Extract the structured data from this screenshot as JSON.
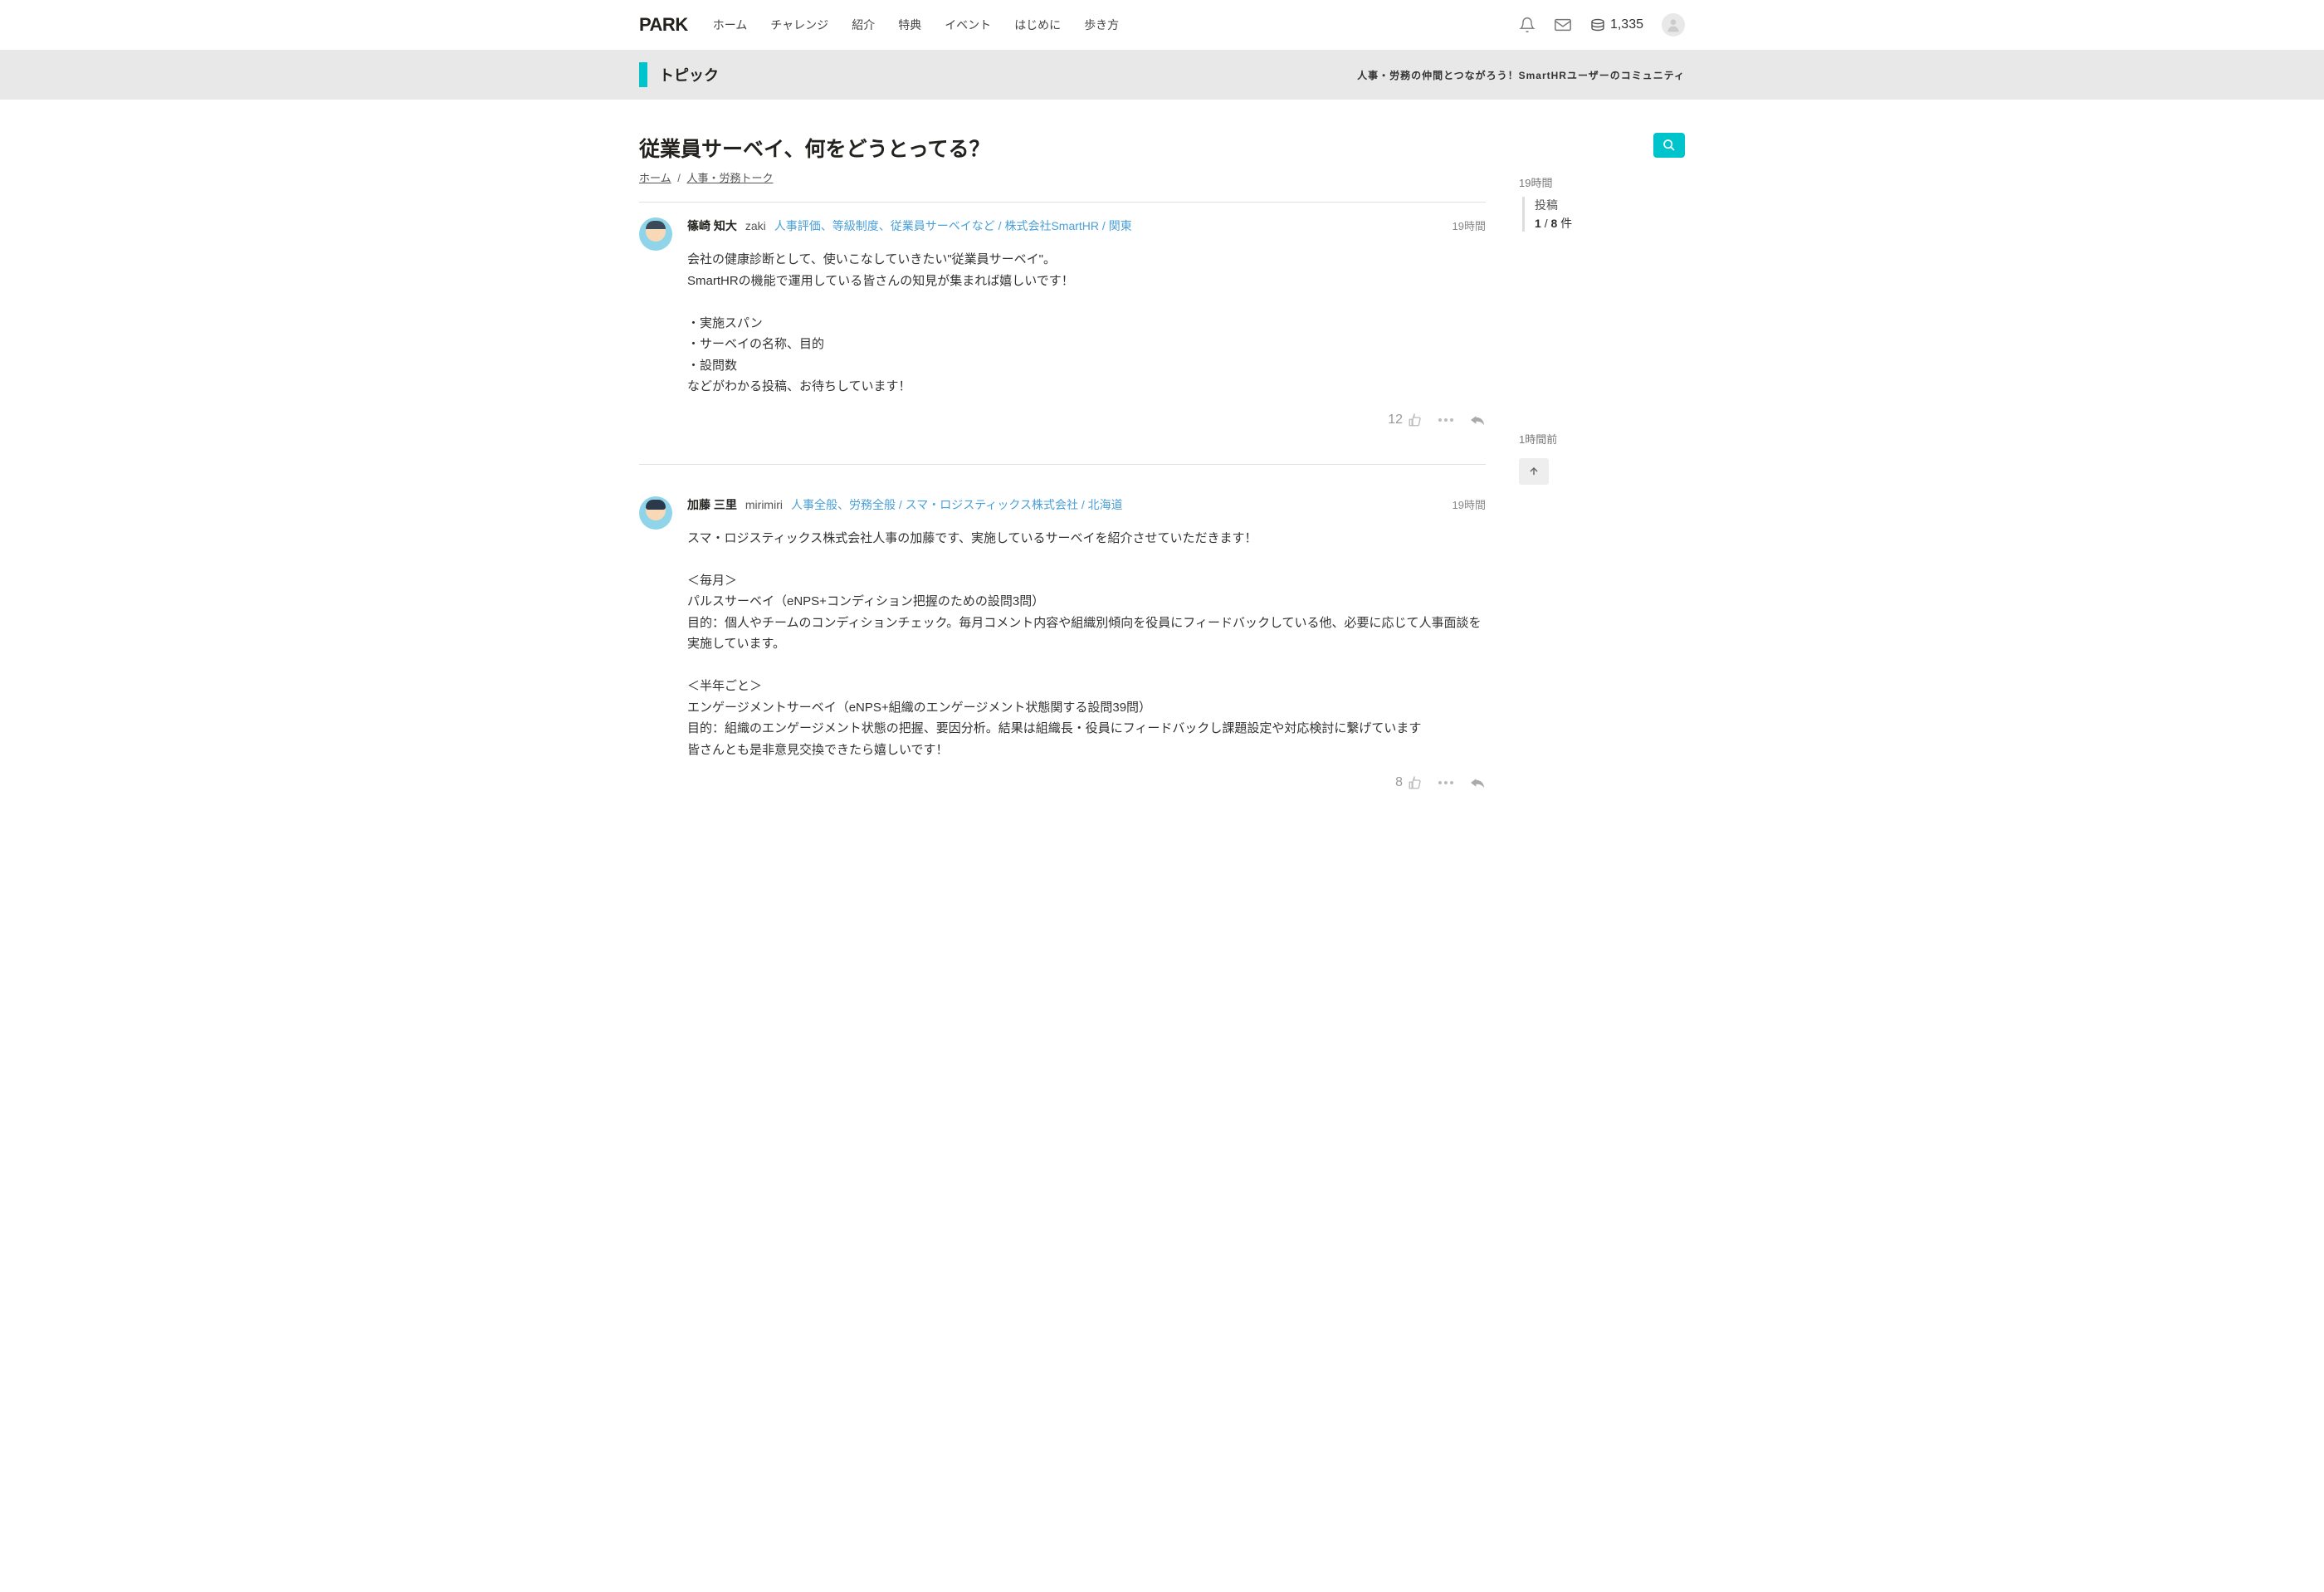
{
  "header": {
    "logo": "PARK",
    "nav": [
      "ホーム",
      "チャレンジ",
      "紹介",
      "特典",
      "イベント",
      "はじめに",
      "歩き方"
    ],
    "points": "1,335"
  },
  "subheader": {
    "title": "トピック",
    "tagline": "人事・労務の仲間とつながろう！SmartHRユーザーのコミュニティ"
  },
  "page": {
    "title": "従業員サーベイ、何をどうとってる？",
    "breadcrumb": {
      "home": "ホーム",
      "sep": "/",
      "category": "人事・労務トーク"
    }
  },
  "posts": [
    {
      "name": "篠崎 知大",
      "nick": "zaki",
      "meta": "人事評価、等級制度、従業員サーベイなど / 株式会社SmartHR / 関東",
      "time": "19時間",
      "body": "会社の健康診断として、使いこなしていきたい\"従業員サーベイ\"。\nSmartHRの機能で運用している皆さんの知見が集まれば嬉しいです！\n\n・実施スパン\n・サーベイの名称、目的\n・設問数\nなどがわかる投稿、お待ちしています！",
      "likes": "12"
    },
    {
      "name": "加藤 三里",
      "nick": "mirimiri",
      "meta": "人事全般、労務全般 / スマ・ロジスティックス株式会社 / 北海道",
      "time": "19時間",
      "body": "スマ・ロジスティックス株式会社人事の加藤です、実施しているサーベイを紹介させていただきます！\n\n＜毎月＞\nパルスサーベイ（eNPS+コンディション把握のための設問3問）\n目的：個人やチームのコンディションチェック。毎月コメント内容や組織別傾向を役員にフィードバックしている他、必要に応じて人事面談を実施しています。\n\n＜半年ごと＞\nエンゲージメントサーベイ（eNPS+組織のエンゲージメント状態関する設問39問）\n目的：組織のエンゲージメント状態の把握、要因分析。結果は組織長・役員にフィードバックし課題設定や対応検討に繋げています\n皆さんとも是非意見交換できたら嬉しいです！",
      "likes": "8"
    }
  ],
  "timeline": {
    "top_time": "19時間",
    "label": "投稿",
    "current": "1",
    "sep": "/",
    "total": "8",
    "unit": "件",
    "bottom_time": "1時間前"
  }
}
